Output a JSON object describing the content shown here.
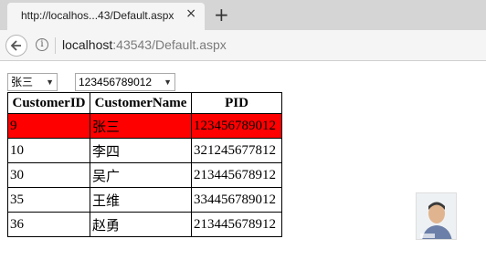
{
  "browser": {
    "tab_title": "http://localhos...43/Default.aspx",
    "tab_close": "×",
    "new_tab": "+",
    "url_host": "localhost",
    "url_rest": ":43543/Default.aspx"
  },
  "filters": {
    "name_select_value": "张三",
    "pid_select_value": "123456789012"
  },
  "table": {
    "headers": [
      "CustomerID",
      "CustomerName",
      "PID"
    ],
    "rows": [
      [
        "9",
        "张三",
        "123456789012"
      ],
      [
        "10",
        "李四",
        "321245677812"
      ],
      [
        "30",
        "吴广",
        "213445678912"
      ],
      [
        "35",
        "王维",
        "334456789012"
      ],
      [
        "36",
        "赵勇",
        "213445678912"
      ]
    ],
    "selected_row_color": "#ff0000"
  },
  "icons": {
    "back": "back-arrow-icon",
    "info": "info-icon",
    "dropdown": "chevron-down-icon"
  }
}
